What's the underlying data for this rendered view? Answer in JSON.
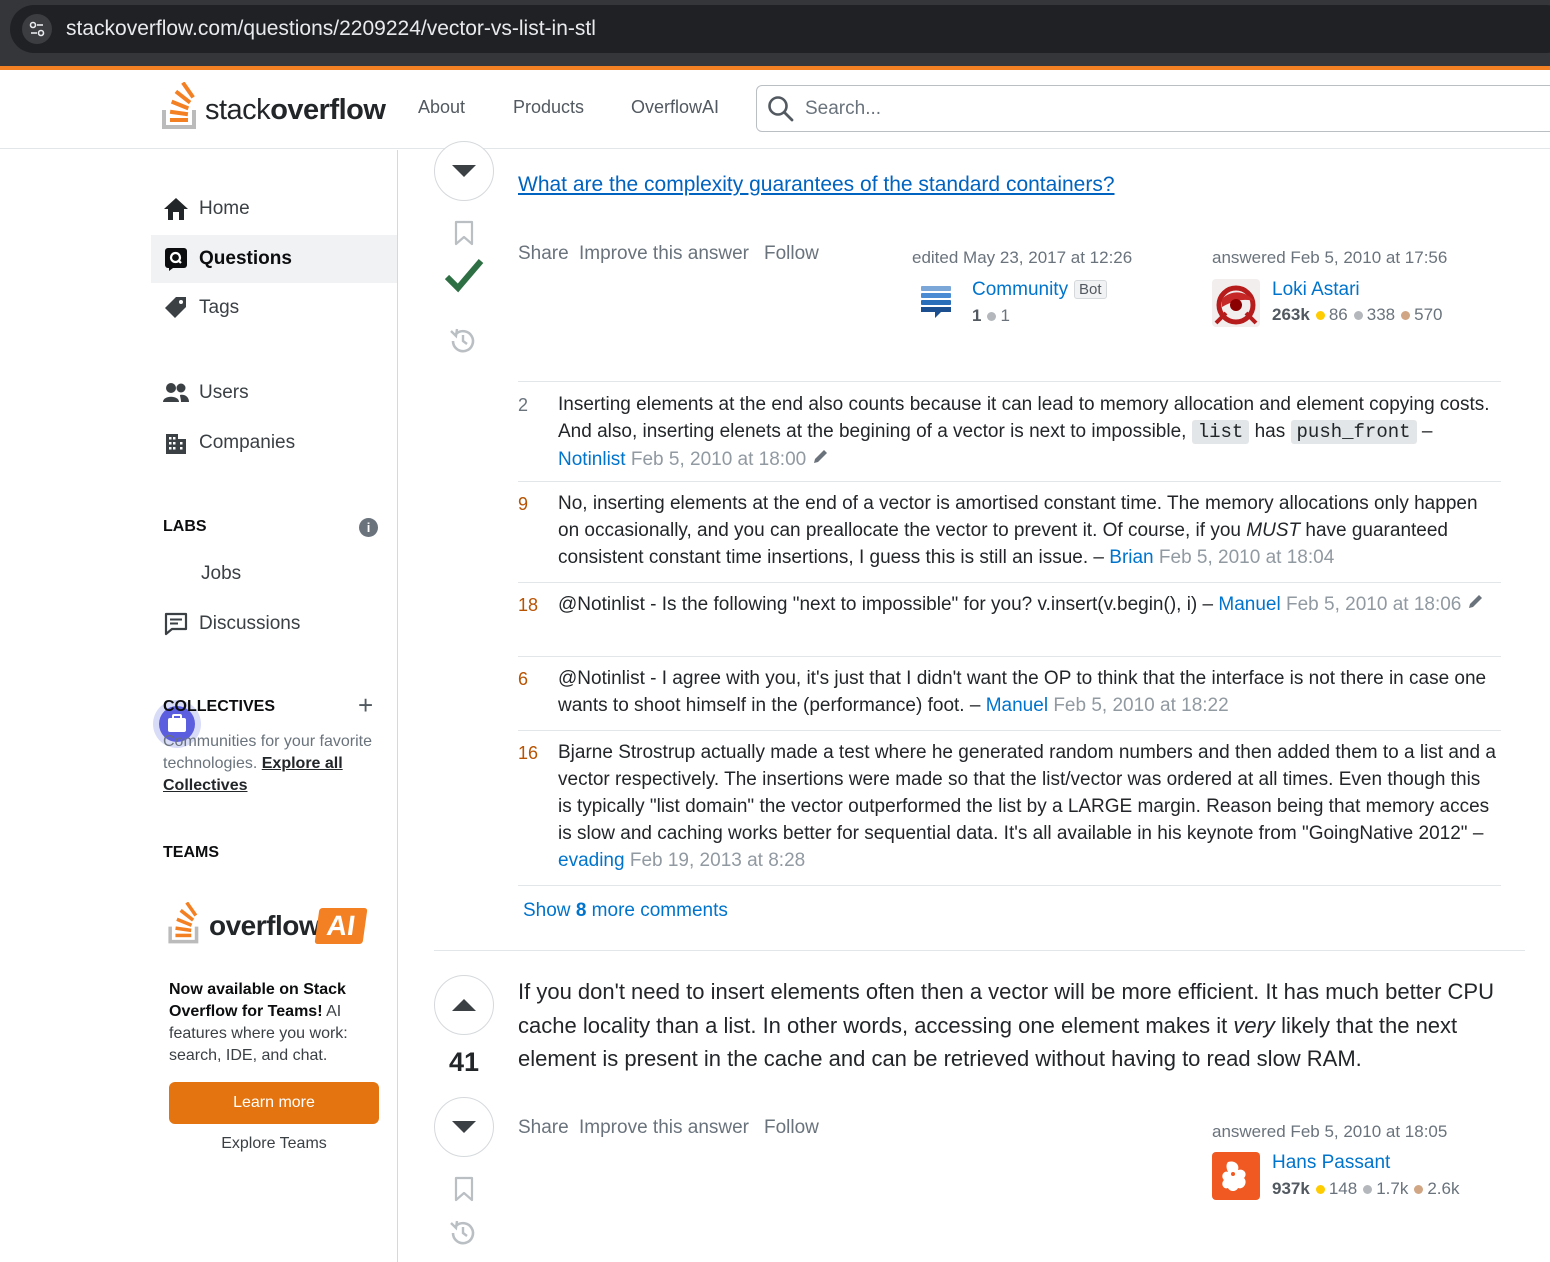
{
  "browser": {
    "url": "stackoverflow.com/questions/2209224/vector-vs-list-in-stl"
  },
  "header": {
    "logo_light": "stack",
    "logo_bold": "overflow",
    "nav": [
      "About",
      "Products",
      "OverflowAI"
    ],
    "search_placeholder": "Search..."
  },
  "sidebar": {
    "items": [
      {
        "label": "Home",
        "icon": "home-icon"
      },
      {
        "label": "Questions",
        "icon": "questions-icon",
        "active": true
      },
      {
        "label": "Tags",
        "icon": "tag-icon"
      },
      {
        "label": "Users",
        "icon": "users-icon"
      },
      {
        "label": "Companies",
        "icon": "building-icon"
      }
    ],
    "labs_heading": "LABS",
    "labs_items": [
      {
        "label": "Jobs",
        "icon": "briefcase-icon"
      },
      {
        "label": "Discussions",
        "icon": "chat-icon"
      }
    ],
    "collectives_heading": "COLLECTIVES",
    "collectives_desc": "Communities for your favorite technologies.",
    "collectives_link": "Explore all Collectives",
    "teams_heading": "TEAMS",
    "overflowai_text": "overflow",
    "overflowai_badge": "AI",
    "teams_desc_bold": "Now available on Stack Overflow for Teams!",
    "teams_desc": "AI features where you work: search, IDE, and chat.",
    "learn_more": "Learn more",
    "explore_teams": "Explore Teams"
  },
  "answer1": {
    "duplicate_link": "What are the complexity guarantees of the standard containers?",
    "menu": [
      "Share",
      "Improve this answer",
      "Follow"
    ],
    "edited": "edited May 23, 2017 at 12:26",
    "editor": {
      "name": "Community",
      "tag": "Bot",
      "rep": "1",
      "silver": "1"
    },
    "answered": "answered Feb 5, 2010 at 17:56",
    "author": {
      "name": "Loki Astari",
      "rep": "263k",
      "gold": "86",
      "silver": "338",
      "bronze": "570"
    },
    "accepted": true
  },
  "comments": [
    {
      "score": "2",
      "text_a": "Inserting elements at the end also counts because it can lead to memory allocation and element copying costs. And also, inserting elenets at the begining of a vector is next to impossible,",
      "code1": "list",
      "mid": "has",
      "code2": "push_front",
      "author": "Notinlist",
      "date": "Feb 5, 2010 at 18:00",
      "edited": true
    },
    {
      "score": "9",
      "text_a": "No, inserting elements at the end of a vector is amortised constant time. The memory allocations only happen on occasionally, and you can preallocate the vector to prevent it. Of course, if you",
      "em": "MUST",
      "text_b": "have guaranteed consistent constant time insertions, I guess this is still an issue.",
      "author": "Brian",
      "date": "Feb 5, 2010 at 18:04"
    },
    {
      "score": "18",
      "text_a": "@Notinlist - Is the following \"next to impossible\" for you? v.insert(v.begin(), i)",
      "author": "Manuel",
      "date": "Feb 5, 2010 at 18:06",
      "edited": true
    },
    {
      "score": "6",
      "text_a": "@Notinlist - I agree with you, it's just that I didn't want the OP to think that the interface is not there in case one wants to shoot himself in the (performance) foot.",
      "author": "Manuel",
      "date": "Feb 5, 2010 at 18:22"
    },
    {
      "score": "16",
      "text_a": "Bjarne Strostrup actually made a test where he generated random numbers and then added them to a list and a vector respectively. The insertions were made so that the list/vector was ordered at all times. Even though this is typically \"list domain\" the vector outperformed the list by a LARGE margin. Reason being that memory acces is slow and caching works better for sequential data. It's all available in his keynote from \"GoingNative 2012\"",
      "author": "evading",
      "date": "Feb 19, 2013 at 8:28"
    }
  ],
  "show_more": {
    "prefix": "Show",
    "count": "8",
    "suffix": "more comments"
  },
  "answer2": {
    "score": "41",
    "body_a": "If you don't need to insert elements often then a vector will be more efficient. It has much better CPU cache locality than a list. In other words, accessing one element makes it",
    "body_em": "very",
    "body_b": "likely that the next element is present in the cache and can be retrieved without having to read slow RAM.",
    "menu": [
      "Share",
      "Improve this answer",
      "Follow"
    ],
    "answered": "answered Feb 5, 2010 at 18:05",
    "author": {
      "name": "Hans Passant",
      "rep": "937k",
      "gold": "148",
      "silver": "1.7k",
      "bronze": "2.6k"
    }
  },
  "colors": {
    "accent": "#f48024",
    "link": "#0074cc",
    "accepted": "#2f6f44",
    "learn_btn": "#e4740f",
    "jobs": "#5b5ede"
  }
}
